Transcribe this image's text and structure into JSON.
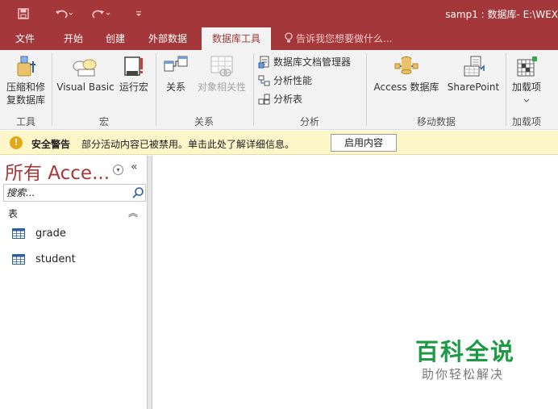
{
  "titlebar": {
    "title": "samp1 : 数据库- E:\\WEX",
    "quick_access": [
      {
        "icon": "save-icon"
      },
      {
        "icon": "undo-icon"
      },
      {
        "icon": "redo-icon"
      },
      {
        "icon": "customize-qat-icon"
      }
    ]
  },
  "tabs": [
    "文件",
    "开始",
    "创建",
    "外部数据",
    "数据库工具"
  ],
  "active_tab": "数据库工具",
  "tell_me": "告诉我您想要做什么...",
  "ribbon": {
    "groups": {
      "tools": "工具",
      "macro": "宏",
      "relationships": "关系",
      "analyze": "分析",
      "move_data": "移动数据",
      "addins": "加载项"
    },
    "compact_repair_line1": "压缩和修",
    "compact_repair_line2": "复数据库",
    "visual_basic": "Visual Basic",
    "run_macro": "运行宏",
    "relationships": "关系",
    "object_dependencies": "对象相关性",
    "documenter": "数据库文档管理器",
    "analyze_performance": "分析性能",
    "analyze_table": "分析表",
    "access_database": "Access 数据库",
    "sharepoint": "SharePoint",
    "addins": "加载项"
  },
  "security_bar": {
    "title": "安全警告",
    "message": "部分活动内容已被禁用。单击此处了解详细信息。",
    "button": "启用内容"
  },
  "nav_pane": {
    "title": "所有 Acce...",
    "search_placeholder": "搜索...",
    "group": "表",
    "items": [
      "grade",
      "student"
    ]
  },
  "watermark": {
    "main": "百科全说",
    "sub": "助你轻松解决"
  },
  "colors": {
    "brand": "#a4373a",
    "ribbon_bg": "#f3f3f3",
    "security_bar": "#fcf6c9",
    "watermark_green": "#1e9a45"
  }
}
